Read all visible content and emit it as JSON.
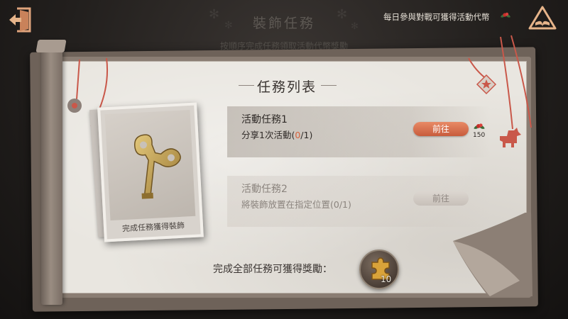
{
  "header": {
    "title": "裝飾任務",
    "subtitle": "按順序完成任務領取活動代幣獎勵",
    "hint": "每日參與對戰可獲得活動代幣"
  },
  "panel": {
    "title": "任務列表",
    "card_caption": "完成任務獲得裝飾",
    "tasks": [
      {
        "name": "活動任務1",
        "desc_prefix": "分享1次活動(",
        "progress_current": "0",
        "desc_suffix": "/1)",
        "button": "前往",
        "reward_count": "150",
        "state": "active"
      },
      {
        "name": "活動任務2",
        "desc": "將裝飾放置在指定位置(0/1)",
        "button": "前往",
        "state": "locked"
      }
    ],
    "complete_reward_label": "完成全部任務可獲得獎勵：",
    "complete_reward_count": "10"
  },
  "colors": {
    "accent": "#d8623c",
    "button_active": "#d66e4b",
    "button_disabled": "#cfc8c1",
    "board": "#e9e6e0",
    "string": "#c9584a"
  },
  "icons": {
    "back": "exit-door-icon",
    "book": "book-icon",
    "hint_currency": "holly-token-icon",
    "reward": "puzzle-piece-icon",
    "decor_key": "wind-up-key-icon"
  }
}
